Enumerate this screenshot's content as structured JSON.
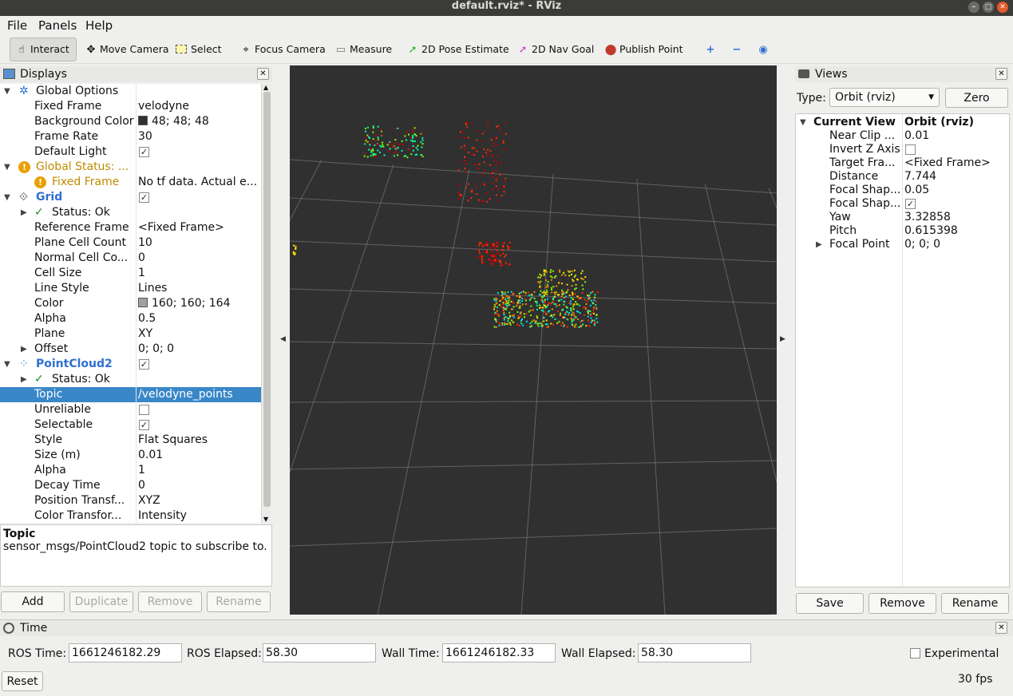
{
  "window": {
    "title": "default.rviz* - RViz"
  },
  "menubar": {
    "items": [
      "File",
      "Panels",
      "Help"
    ]
  },
  "toolbar": {
    "tools": [
      {
        "label": "Interact",
        "icon": "hand-pointer-icon"
      },
      {
        "label": "Move Camera",
        "icon": "move-camera-icon"
      },
      {
        "label": "Select",
        "icon": "select-box-icon"
      },
      {
        "label": "Focus Camera",
        "icon": "focus-crosshair-icon"
      },
      {
        "label": "Measure",
        "icon": "ruler-icon"
      },
      {
        "label": "2D Pose Estimate",
        "icon": "green-arrow-icon"
      },
      {
        "label": "2D Nav Goal",
        "icon": "pink-arrow-icon"
      },
      {
        "label": "Publish Point",
        "icon": "map-pin-icon"
      }
    ]
  },
  "displays": {
    "title": "Displays",
    "rows": [
      {
        "label": "Global Options",
        "value": ""
      },
      {
        "label": "Fixed Frame",
        "value": "velodyne"
      },
      {
        "label": "Background Color",
        "value": "48; 48; 48",
        "swatch": "#303030"
      },
      {
        "label": "Frame Rate",
        "value": "30"
      },
      {
        "label": "Default Light",
        "check": "✓"
      },
      {
        "label": "Global Status: ...",
        "value": ""
      },
      {
        "label": "Fixed Frame",
        "value": "No tf data.  Actual e..."
      },
      {
        "label": "Grid",
        "check": "✓"
      },
      {
        "label": "Status: Ok",
        "value": ""
      },
      {
        "label": "Reference Frame",
        "value": "<Fixed Frame>"
      },
      {
        "label": "Plane Cell Count",
        "value": "10"
      },
      {
        "label": "Normal Cell Co...",
        "value": "0"
      },
      {
        "label": "Cell Size",
        "value": "1"
      },
      {
        "label": "Line Style",
        "value": "Lines"
      },
      {
        "label": "Color",
        "value": "160; 160; 164",
        "swatch": "#a0a0a4"
      },
      {
        "label": "Alpha",
        "value": "0.5"
      },
      {
        "label": "Plane",
        "value": "XY"
      },
      {
        "label": "Offset",
        "value": "0; 0; 0"
      },
      {
        "label": "PointCloud2",
        "check": "✓"
      },
      {
        "label": "Status: Ok",
        "value": ""
      },
      {
        "label": "Topic",
        "value": "/velodyne_points"
      },
      {
        "label": "Unreliable",
        "check": ""
      },
      {
        "label": "Selectable",
        "check": "✓"
      },
      {
        "label": "Style",
        "value": "Flat Squares"
      },
      {
        "label": "Size (m)",
        "value": "0.01"
      },
      {
        "label": "Alpha",
        "value": "1"
      },
      {
        "label": "Decay Time",
        "value": "0"
      },
      {
        "label": "Position Transf...",
        "value": "XYZ"
      },
      {
        "label": "Color Transfor...",
        "value": "Intensity"
      }
    ],
    "description": {
      "title": "Topic",
      "text": "sensor_msgs/PointCloud2 topic to subscribe to."
    },
    "buttons": {
      "add": "Add",
      "duplicate": "Duplicate",
      "remove": "Remove",
      "rename": "Rename"
    }
  },
  "views": {
    "title": "Views",
    "type_label": "Type:",
    "type_value": "Orbit (rviz)",
    "zero": "Zero",
    "header": {
      "label": "Current View",
      "value": "Orbit (rviz)"
    },
    "rows": [
      {
        "label": "Near Clip ...",
        "value": "0.01"
      },
      {
        "label": "Invert Z Axis",
        "check": ""
      },
      {
        "label": "Target Fra...",
        "value": "<Fixed Frame>"
      },
      {
        "label": "Distance",
        "value": "7.744"
      },
      {
        "label": "Focal Shap...",
        "value": "0.05"
      },
      {
        "label": "Focal Shap...",
        "check": "✓"
      },
      {
        "label": "Yaw",
        "value": "3.32858"
      },
      {
        "label": "Pitch",
        "value": "0.615398"
      },
      {
        "label": "Focal Point",
        "value": "0; 0; 0"
      }
    ],
    "buttons": {
      "save": "Save",
      "remove": "Remove",
      "rename": "Rename"
    }
  },
  "time": {
    "title": "Time",
    "ros_time_label": "ROS Time:",
    "ros_time": "1661246182.29",
    "ros_elapsed_label": "ROS Elapsed:",
    "ros_elapsed": "58.30",
    "wall_time_label": "Wall Time:",
    "wall_time": "1661246182.33",
    "wall_elapsed_label": "Wall Elapsed:",
    "wall_elapsed": "58.30",
    "experimental": "Experimental",
    "reset": "Reset",
    "fps": "30 fps"
  },
  "colors": {
    "background": "#303030",
    "grid": "#a0a0a4",
    "selection": "#3a87c8",
    "warning": "#e8a000"
  }
}
